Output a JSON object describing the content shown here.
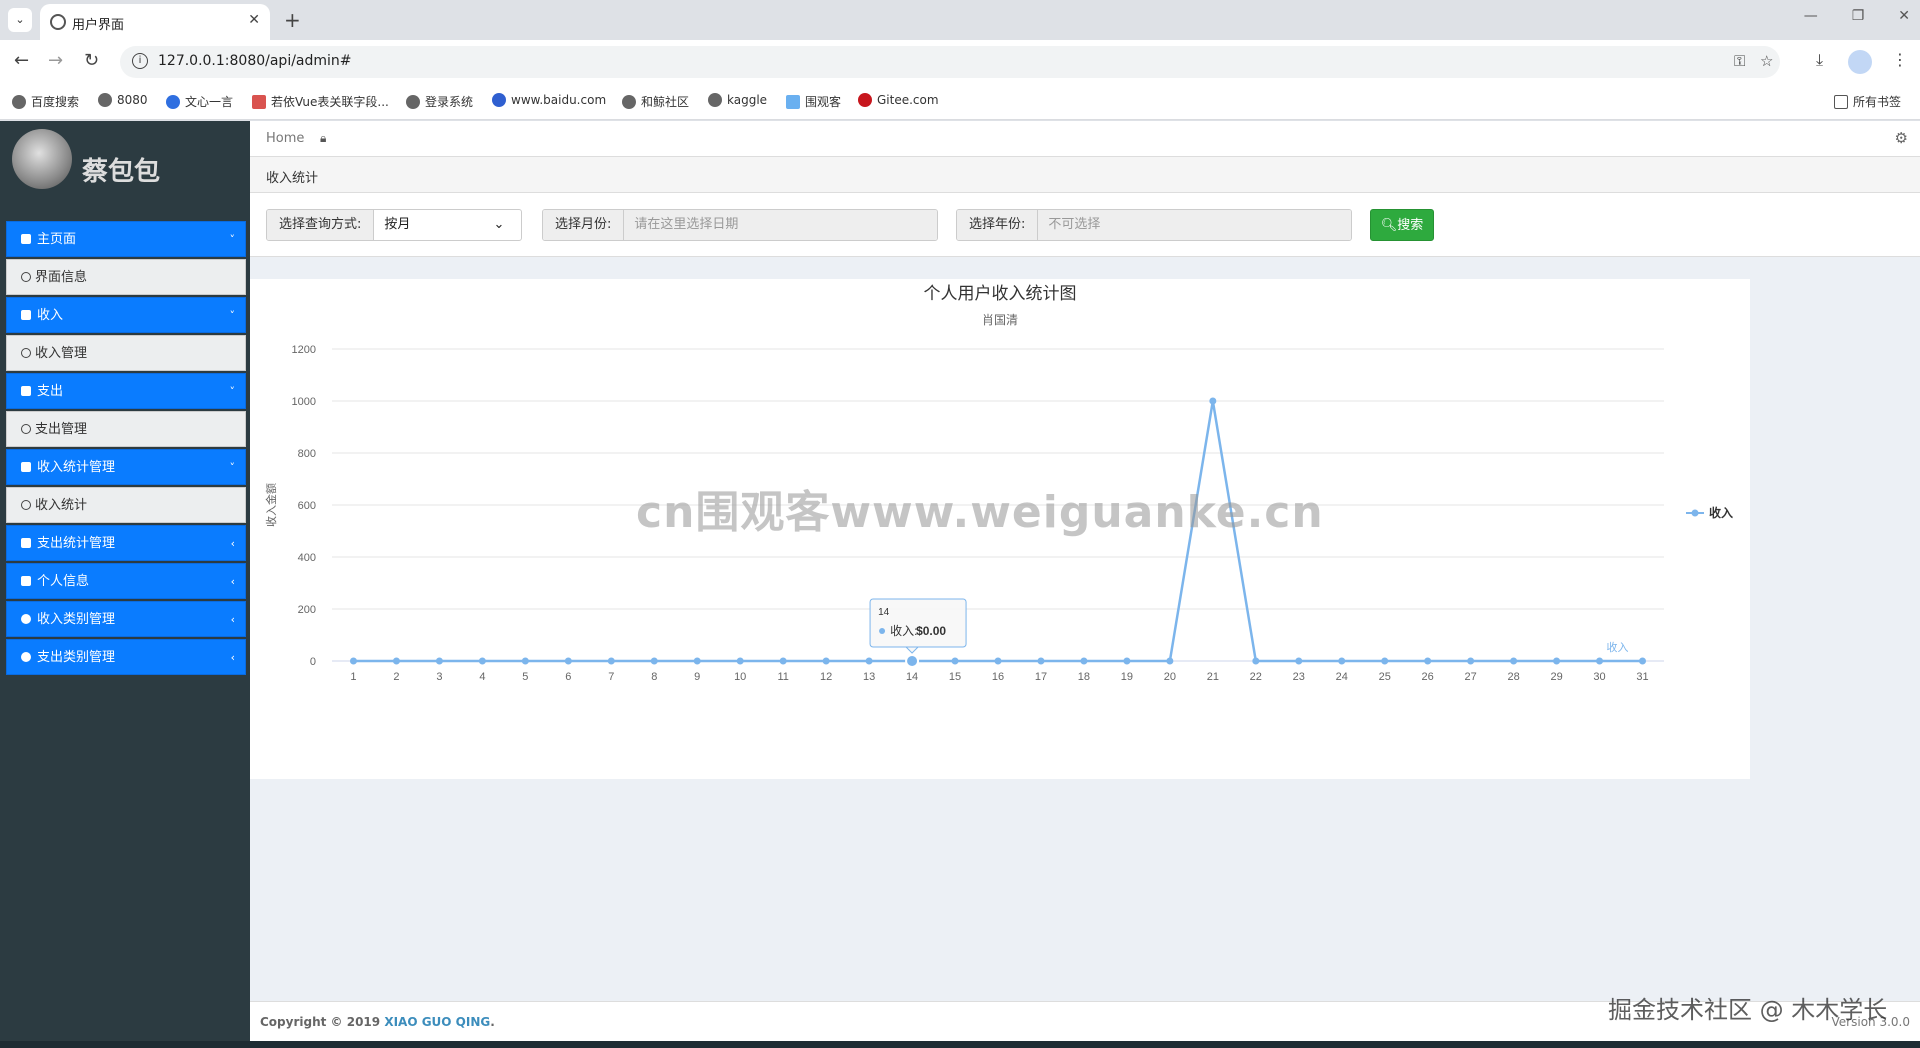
{
  "browser": {
    "tab_title": "用户界面",
    "url": "127.0.0.1:8080/api/admin#",
    "bookmarks": [
      "百度搜索",
      "8080",
      "文心一言",
      "若依Vue表关联字段...",
      "登录系统",
      "www.baidu.com",
      "和鲸社区",
      "kaggle",
      "围观客",
      "Gitee.com"
    ],
    "all_bookmarks": "所有书签"
  },
  "sidebar": {
    "user_name": "蔡包包",
    "items": [
      {
        "label": "主页面",
        "type": "parent",
        "caret": "˅"
      },
      {
        "label": "界面信息",
        "type": "child"
      },
      {
        "label": "收入",
        "type": "parent",
        "caret": "˅"
      },
      {
        "label": "收入管理",
        "type": "child"
      },
      {
        "label": "支出",
        "type": "parent",
        "caret": "˅"
      },
      {
        "label": "支出管理",
        "type": "child"
      },
      {
        "label": "收入统计管理",
        "type": "parent",
        "caret": "˅"
      },
      {
        "label": "收入统计",
        "type": "child"
      },
      {
        "label": "支出统计管理",
        "type": "parent",
        "caret": "‹"
      },
      {
        "label": "个人信息",
        "type": "parent",
        "caret": "‹"
      },
      {
        "label": "收入类别管理",
        "type": "parent",
        "caret": "‹"
      },
      {
        "label": "支出类别管理",
        "type": "parent",
        "caret": "‹"
      }
    ]
  },
  "breadcrumb": {
    "home": "Home"
  },
  "page_title": "收入统计",
  "filters": {
    "query_mode_label": "选择查询方式:",
    "query_mode_value": "按月",
    "month_label": "选择月份:",
    "month_placeholder": "请在这里选择日期",
    "year_label": "选择年份:",
    "year_placeholder": "不可选择",
    "search_label": "搜索"
  },
  "chart_data": {
    "type": "line",
    "title": "个人用户收入统计图",
    "subtitle": "肖国清",
    "ylabel": "收入金额",
    "xlabel": "",
    "categories": [
      "1",
      "2",
      "3",
      "4",
      "5",
      "6",
      "7",
      "8",
      "9",
      "10",
      "11",
      "12",
      "13",
      "14",
      "15",
      "16",
      "17",
      "18",
      "19",
      "20",
      "21",
      "22",
      "23",
      "24",
      "25",
      "26",
      "27",
      "28",
      "29",
      "30",
      "31"
    ],
    "series": [
      {
        "name": "收入",
        "values": [
          0,
          0,
          0,
          0,
          0,
          0,
          0,
          0,
          0,
          0,
          0,
          0,
          0,
          0,
          0,
          0,
          0,
          0,
          0,
          0,
          1000,
          0,
          0,
          0,
          0,
          0,
          0,
          0,
          0,
          0,
          0
        ]
      }
    ],
    "ylim": [
      0,
      1200
    ],
    "yticks": [
      0,
      200,
      400,
      600,
      800,
      1000,
      1200
    ],
    "legend": "right",
    "series_end_label": "收入",
    "color": "#7cb5ec",
    "tooltip": {
      "category": "14",
      "series": "收入",
      "value": "$0.00"
    }
  },
  "footer": {
    "copyright_prefix": "Copyright © 2019",
    "copyright_name": "XIAO GUO QING",
    "copyright_suffix": ".",
    "version": "Version 3.0.0"
  },
  "watermarks": {
    "center": "cn围观客www.weiguanke.cn",
    "corner": "掘金技术社区 @ 木木学长"
  }
}
